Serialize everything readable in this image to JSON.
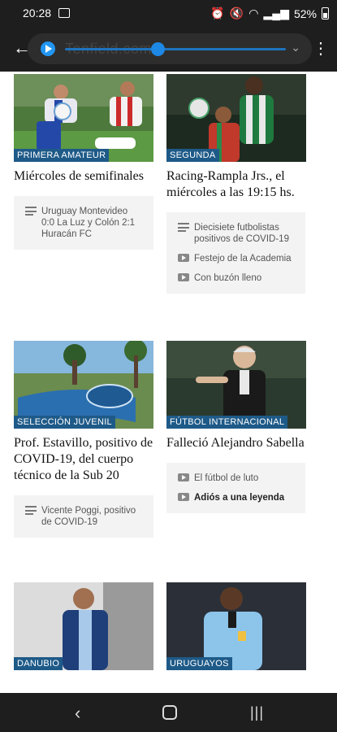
{
  "status": {
    "time": "20:28",
    "battery": "52%"
  },
  "player": {
    "url": "Tenfield.com",
    "progress": 0.42
  },
  "cards": [
    {
      "category": "PRIMERA AMATEUR",
      "title": "Miércoles de semifinales",
      "related": [
        {
          "icon": "text-icon",
          "text": "Uruguay Montevideo 0:0 La Luz y Colón 2:1 Huracán FC",
          "bold": false
        }
      ]
    },
    {
      "category": "SEGUNDA",
      "title": "Racing-Rampla Jrs., el miércoles a las 19:15 hs.",
      "related": [
        {
          "icon": "text-icon",
          "text": "Diecisiete futbolistas positivos de COVID-19",
          "bold": false
        },
        {
          "icon": "video-icon",
          "text": "Festejo de la Academia",
          "bold": false
        },
        {
          "icon": "video-icon",
          "text": "Con buzón lleno",
          "bold": false
        }
      ]
    },
    {
      "category": "SELECCIÓN JUVENIL",
      "title": "Prof. Estavillo, positivo de COVID-19, del cuerpo técnico de la Sub 20",
      "related": [
        {
          "icon": "text-icon",
          "text": "Vicente Poggi, positivo de COVID-19",
          "bold": false
        }
      ]
    },
    {
      "category": "FÚTBOL INTERNACIONAL",
      "title": "Falleció Alejandro Sabella",
      "related": [
        {
          "icon": "video-icon",
          "text": "El fútbol de luto",
          "bold": false
        },
        {
          "icon": "video-icon",
          "text": "Adiós a una leyenda",
          "bold": true
        }
      ]
    },
    {
      "category": "DANUBIO",
      "title": "",
      "related": []
    },
    {
      "category": "URUGUAYOS",
      "title": "",
      "related": []
    }
  ],
  "colors": {
    "category_bg": "#1e5a88",
    "topbar": "#1e1e1e",
    "accent": "#2196f3"
  }
}
